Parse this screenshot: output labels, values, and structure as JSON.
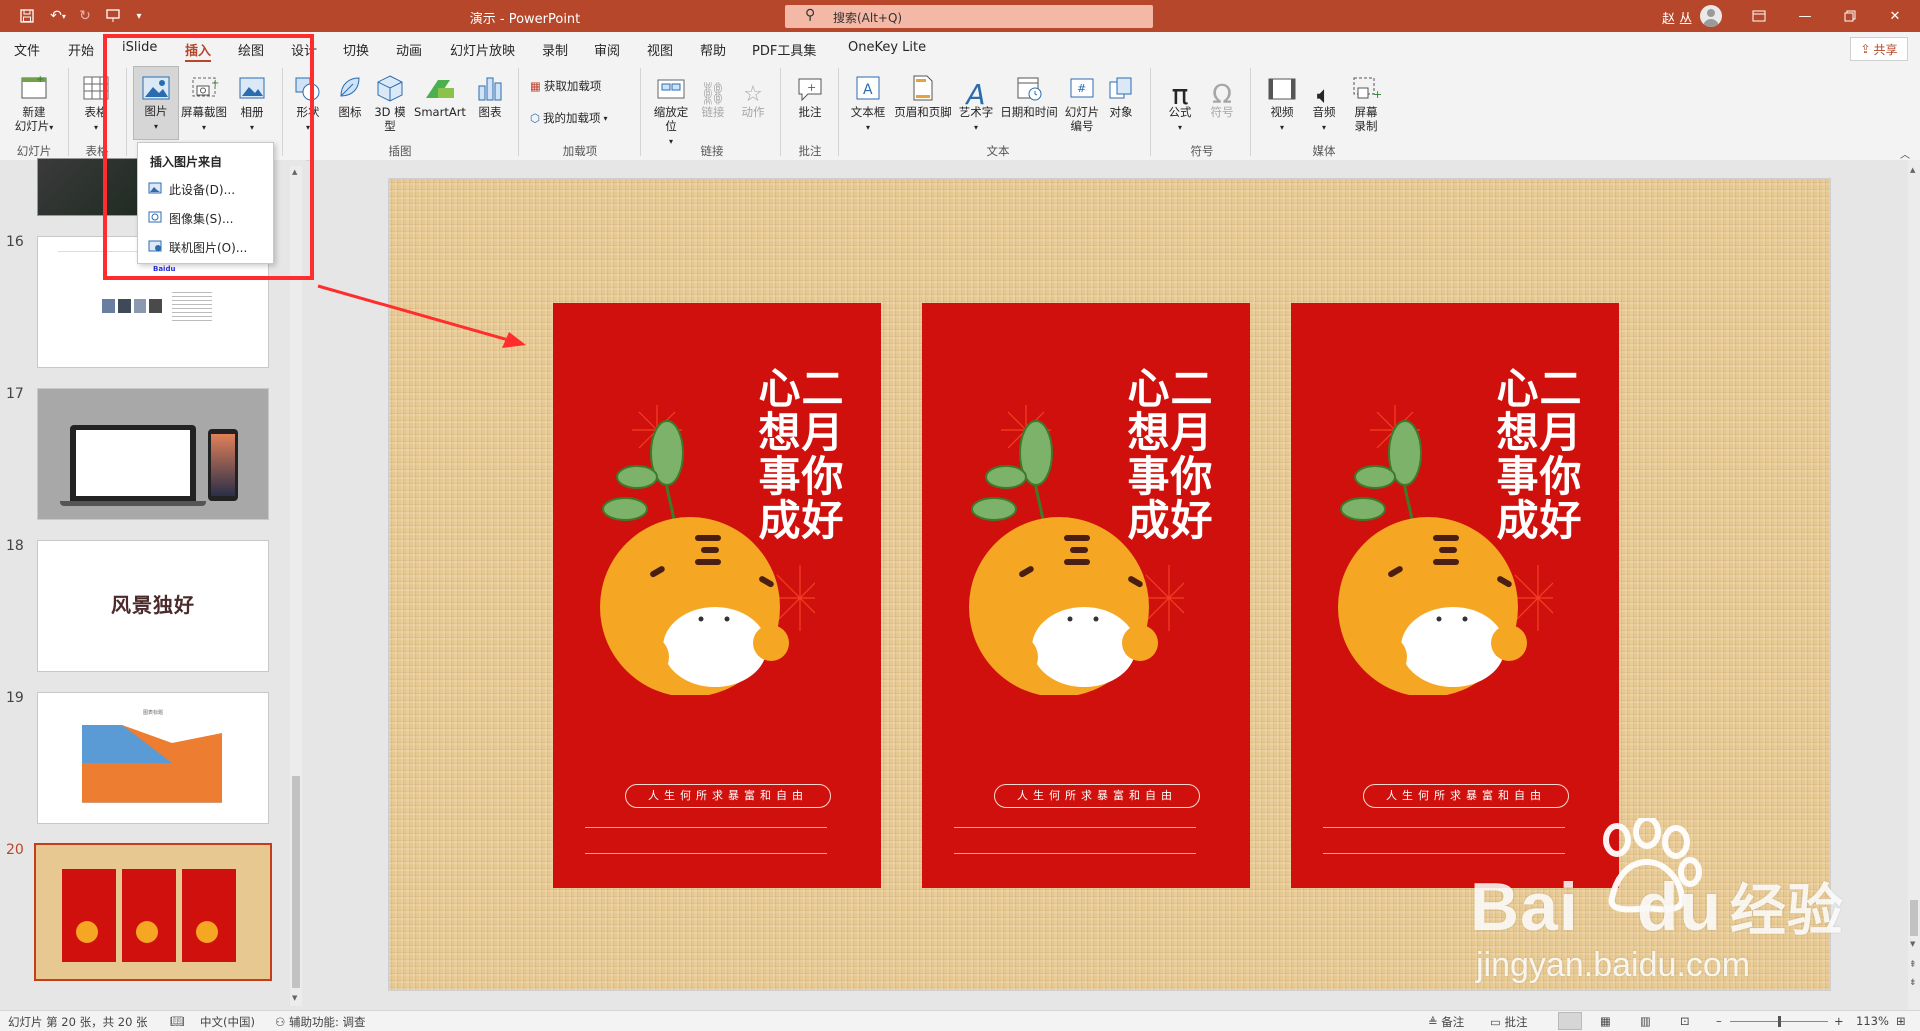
{
  "titlebar": {
    "doc_name": "演示",
    "app": "PowerPoint",
    "title_sep": " - ",
    "search": "搜索(Alt+Q)",
    "user": "赵 丛"
  },
  "tabs": [
    "文件",
    "开始",
    "iSlide",
    "插入",
    "绘图",
    "设计",
    "切换",
    "动画",
    "幻灯片放映",
    "录制",
    "审阅",
    "视图",
    "帮助",
    "PDF工具集",
    "OneKey Lite"
  ],
  "active_tab": "插入",
  "share": "共享",
  "ribbon": {
    "new_slide": "新建\n幻灯片",
    "table": "表格",
    "picture": "图片",
    "screenshot": "屏幕截图",
    "album": "相册",
    "shapes": "形状",
    "icons": "图标",
    "model3d": "3D 模型",
    "smartart": "SmartArt",
    "chart": "图表",
    "get_addins": "获取加载项",
    "my_addins": "我的加载项",
    "zoom": "缩放定位",
    "link": "链接",
    "action": "动作",
    "comment": "批注",
    "textbox": "文本框",
    "header_footer": "页眉和页脚",
    "wordart": "艺术字",
    "datetime": "日期和时间",
    "slide_number": "幻灯片编号",
    "object": "对象",
    "equation": "公式",
    "symbol": "符号",
    "video": "视频",
    "audio": "音频",
    "screen_record": "屏幕录制",
    "groups": {
      "slides": "幻灯片",
      "tables": "表格",
      "illustrations": "插图",
      "addins": "加载项",
      "links": "链接",
      "comments": "批注",
      "text": "文本",
      "symbols": "符号",
      "media": "媒体"
    }
  },
  "dropdown": {
    "title": "插入图片来自",
    "items": [
      "此设备(D)...",
      "图像集(S)...",
      "联机图片(O)..."
    ]
  },
  "slides": {
    "numbers": [
      "16",
      "17",
      "18",
      "19",
      "20"
    ],
    "slide18_text": "风景独好",
    "slide19_chart_title": "图表标题",
    "slide16_logo": "Baidu"
  },
  "card": {
    "title_col1": "二月你好",
    "title_col2": "心想事成",
    "subtitle": "人生何所求暴富和自由"
  },
  "status": {
    "slide_info": "幻灯片 第 20 张，共 20 张",
    "language": "中文(中国)",
    "accessibility": "辅助功能: 调查",
    "notes": "备注",
    "comments": "批注",
    "zoom": "113%"
  },
  "watermark": {
    "brand": "Bai",
    "brand2": "du",
    "brand_cn": "经验",
    "url": "jingyan.baidu.com"
  },
  "colors": {
    "accent": "#b7472a",
    "card_red": "#d0100c",
    "annotation_red": "#ff2d2d"
  }
}
